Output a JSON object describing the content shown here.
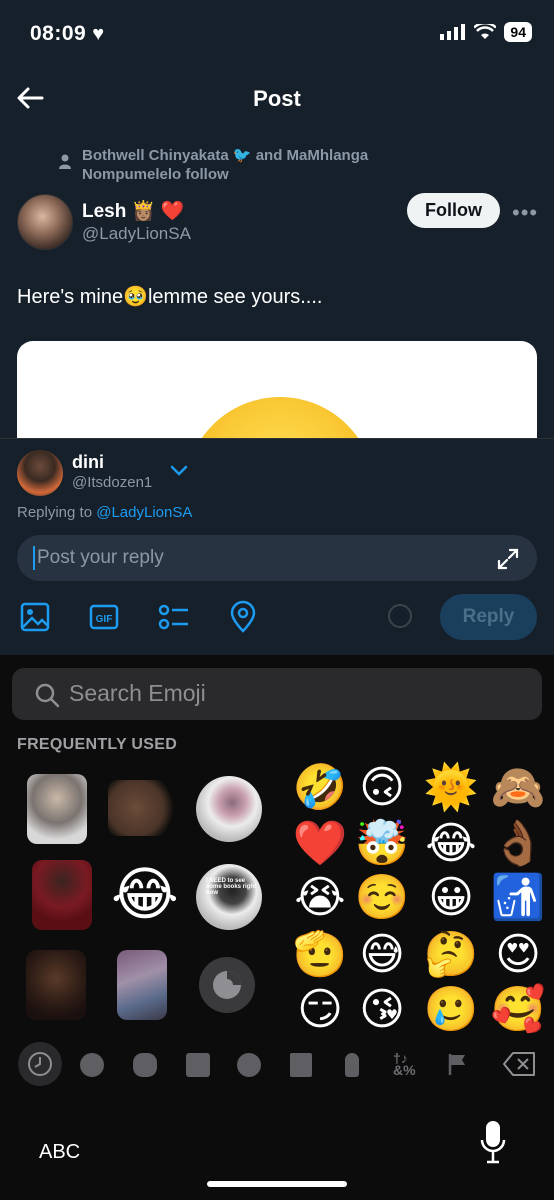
{
  "status": {
    "time": "08:09",
    "battery": "94"
  },
  "header": {
    "title": "Post"
  },
  "post": {
    "social_context": "Bothwell Chinyakata 🐦 and MaMhlanga Nompumelelo follow",
    "author_name": "Lesh 👸🏽 ❤️",
    "author_handle": "@LadyLionSA",
    "follow_label": "Follow",
    "more": "•••",
    "text": "Here's mine🥹lemme see yours...."
  },
  "composer": {
    "user_name": "dini",
    "user_handle": "@Itsdozen1",
    "replying_prefix": "Replying to ",
    "replying_handle": "@LadyLionSA",
    "placeholder": "Post your reply",
    "reply_label": "Reply",
    "tools": [
      "image-icon",
      "gif-icon",
      "poll-icon",
      "location-icon"
    ]
  },
  "keyboard": {
    "search_placeholder": "Search Emoji",
    "section_label": "FREQUENTLY USED",
    "emoji_rows": [
      [
        "🤣",
        "🙃",
        "🌞",
        "🙈"
      ],
      [
        "❤️",
        "🤯",
        "😂",
        "👌🏾"
      ],
      [
        "😭",
        "☺️",
        "😀",
        "🚮"
      ],
      [
        "🫡",
        "😅",
        "🤔",
        "😍"
      ],
      [
        "😏",
        "😘",
        "🥲",
        "🥰"
      ]
    ],
    "stickers": [
      "sticker-person-1",
      "sticker-food",
      "sticker-brain",
      "sticker-person-red",
      "😂",
      "sticker-brain-text",
      "sticker-man-thinking",
      "sticker-collage",
      "sticker-add"
    ],
    "sticker_text": "I NEED to see some books right now",
    "categories": [
      "recent-icon",
      "smiley-icon",
      "animal-icon",
      "food-icon",
      "activity-icon",
      "travel-icon",
      "objects-icon",
      "symbols-icon",
      "flags-icon",
      "delete-icon"
    ],
    "abc_label": "ABC"
  },
  "colors": {
    "accent": "#1d9bf0",
    "background": "#15202b",
    "keyboard": "#0c0c0c"
  }
}
